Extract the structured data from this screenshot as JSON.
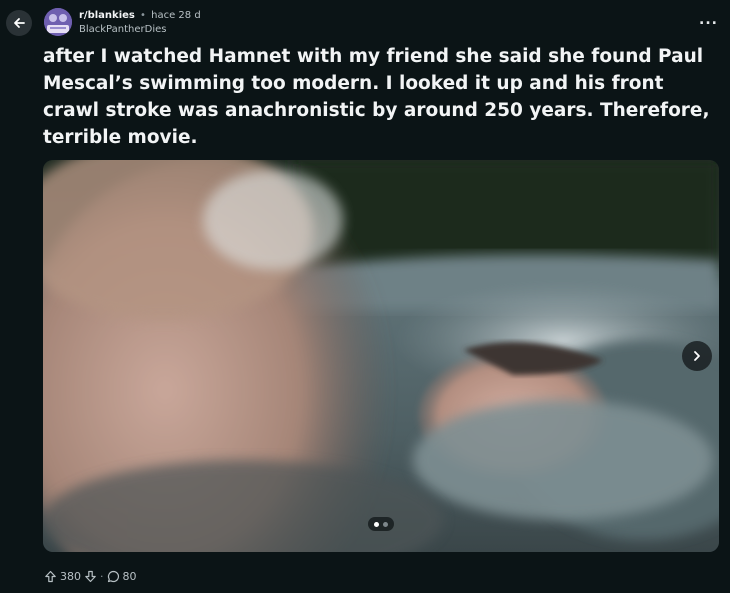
{
  "header": {
    "subreddit": "r/blankies",
    "time_ago": "hace 28 d",
    "author": "BlackPantherDies",
    "back_icon": "arrow-left-icon",
    "more_icon": "ellipsis-icon",
    "more_label": "..."
  },
  "post": {
    "title": "after I watched Hamnet with my friend she said she found Paul Mescal’s swimming too modern. I looked it up and his front crawl stroke was anachronistic by around 250 years. Therefore, terrible movie."
  },
  "gallery": {
    "current_index": 1,
    "total_images": 2,
    "next_icon": "chevron-right-icon"
  },
  "actions": {
    "upvote_icon": "arrow-up-icon",
    "score": "380",
    "downvote_icon": "arrow-down-icon",
    "separator": "·",
    "comment_icon": "comment-bubble-icon",
    "comments": "80"
  },
  "colors": {
    "background": "#0b1416",
    "text": "#f2f4f5",
    "muted": "#b7c0c4"
  }
}
